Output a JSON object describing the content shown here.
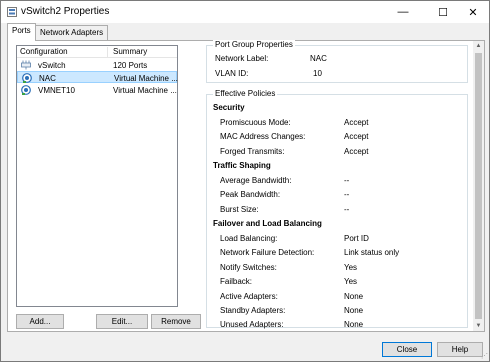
{
  "window": {
    "title": "vSwitch2 Properties"
  },
  "title_buttons": {
    "minimize": "—",
    "maximize": "☐",
    "close": "✕"
  },
  "tabs": [
    {
      "label": "Ports"
    },
    {
      "label": "Network Adapters"
    }
  ],
  "list": {
    "columns": [
      "Configuration",
      "Summary"
    ],
    "rows": [
      {
        "name": "vSwitch",
        "summary": "120 Ports",
        "icon": "vswitch-icon"
      },
      {
        "name": "NAC",
        "summary": "Virtual Machine ...",
        "icon": "portgroup-icon",
        "selected": true
      },
      {
        "name": "VMNET10",
        "summary": "Virtual Machine ...",
        "icon": "portgroup-icon"
      }
    ]
  },
  "list_buttons": {
    "add": "Add...",
    "edit": "Edit...",
    "remove": "Remove"
  },
  "port_group": {
    "title": "Port Group Properties",
    "network_label_key": "Network Label:",
    "network_label_value": "NAC",
    "vlan_key": "VLAN ID:",
    "vlan_value": "10"
  },
  "policies": {
    "title": "Effective Policies",
    "security": {
      "heading": "Security",
      "items": [
        {
          "label": "Promiscuous Mode:",
          "value": "Accept"
        },
        {
          "label": "MAC Address Changes:",
          "value": "Accept"
        },
        {
          "label": "Forged Transmits:",
          "value": "Accept"
        }
      ]
    },
    "traffic": {
      "heading": "Traffic Shaping",
      "items": [
        {
          "label": "Average Bandwidth:",
          "value": "--"
        },
        {
          "label": "Peak Bandwidth:",
          "value": "--"
        },
        {
          "label": "Burst Size:",
          "value": "--"
        }
      ]
    },
    "failover": {
      "heading": "Failover and Load Balancing",
      "items": [
        {
          "label": "Load Balancing:",
          "value": "Port ID"
        },
        {
          "label": "Network Failure Detection:",
          "value": "Link status only"
        },
        {
          "label": "Notify Switches:",
          "value": "Yes"
        },
        {
          "label": "Failback:",
          "value": "Yes"
        },
        {
          "label": "Active Adapters:",
          "value": "None"
        },
        {
          "label": "Standby Adapters:",
          "value": "None"
        },
        {
          "label": "Unused Adapters:",
          "value": "None"
        }
      ]
    }
  },
  "dialog_buttons": {
    "close": "Close",
    "help": "Help"
  },
  "colors": {
    "selection": "#cce8ff",
    "selection_border": "#99d1ff",
    "icon_blue": "#2a6fb8"
  }
}
